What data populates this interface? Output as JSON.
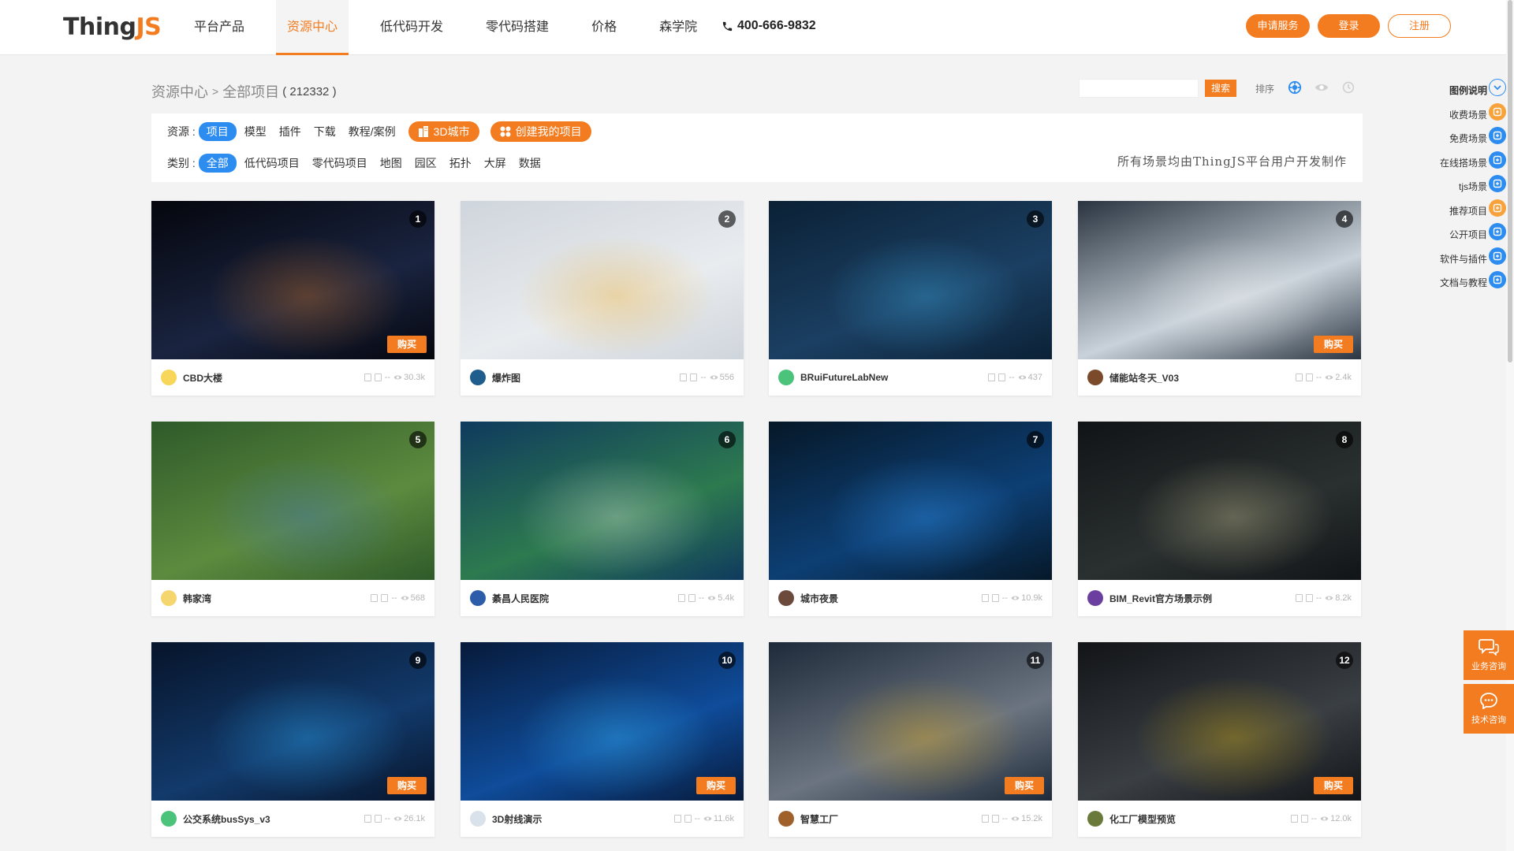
{
  "header": {
    "logo_main": "Thing",
    "logo_accent": "JS",
    "nav": [
      {
        "label": "平台产品"
      },
      {
        "label": "资源中心"
      },
      {
        "label": "低代码开发"
      },
      {
        "label": "零代码搭建"
      },
      {
        "label": "价格"
      },
      {
        "label": "森学院"
      }
    ],
    "active_nav": "资源中心",
    "phone": "400-666-9832",
    "apply_label": "申请服务",
    "login_label": "登录",
    "register_label": "注册"
  },
  "breadcrumb": {
    "root": "资源中心",
    "separator": ">",
    "current": "全部项目",
    "count": "( 212332 )"
  },
  "toolbar": {
    "search_button": "搜索",
    "sort_label": "排序"
  },
  "filters": {
    "resource_label": "资源 :",
    "resource_items": [
      {
        "label": "项目",
        "selected": true
      },
      {
        "label": "模型",
        "selected": false
      },
      {
        "label": "插件",
        "selected": false
      },
      {
        "label": "下载",
        "selected": false
      },
      {
        "label": "教程/案例",
        "selected": false
      }
    ],
    "city_button": "3D城市",
    "create_button": "创建我的项目",
    "category_label": "类别 :",
    "category_items": [
      {
        "label": "全部",
        "selected": true
      },
      {
        "label": "低代码项目",
        "selected": false
      },
      {
        "label": "零代码项目",
        "selected": false
      },
      {
        "label": "地图",
        "selected": false
      },
      {
        "label": "园区",
        "selected": false
      },
      {
        "label": "拓扑",
        "selected": false
      },
      {
        "label": "大屏",
        "selected": false
      },
      {
        "label": "数据",
        "selected": false
      }
    ],
    "disclaimer": "所有场景均由ThingJS平台用户开发制作"
  },
  "legend": {
    "title": "图例说明",
    "items": [
      {
        "label": "收费场景",
        "icon": "paid-scene-icon",
        "color": "#f7a23b"
      },
      {
        "label": "免费场景",
        "icon": "free-scene-icon",
        "color": "#2d8cf0"
      },
      {
        "label": "在线搭场景",
        "icon": "online-build-icon",
        "color": "#2d8cf0"
      },
      {
        "label": "tjs场景",
        "icon": "tjs-scene-icon",
        "color": "#2d8cf0"
      },
      {
        "label": "推荐项目",
        "icon": "recommend-icon",
        "color": "#f7a23b"
      },
      {
        "label": "公开项目",
        "icon": "public-project-icon",
        "color": "#2d8cf0"
      },
      {
        "label": "软件与插件",
        "icon": "software-plugin-icon",
        "color": "#2d8cf0"
      },
      {
        "label": "文档与教程",
        "icon": "docs-tutorial-icon",
        "color": "#2d8cf0"
      }
    ]
  },
  "float_buttons": {
    "business": "业务咨询",
    "tech": "技术咨询"
  },
  "projects": [
    {
      "num": "1",
      "title": "CBD大楼",
      "views": "30.3k",
      "buy": "购买",
      "dash": "--"
    },
    {
      "num": "2",
      "title": "爆炸图",
      "views": "556",
      "buy": "",
      "dash": "--"
    },
    {
      "num": "3",
      "title": "BRuiFutureLabNew",
      "views": "437",
      "buy": "",
      "dash": "--"
    },
    {
      "num": "4",
      "title": "储能站冬天_V03",
      "views": "2.4k",
      "buy": "购买",
      "dash": "--"
    },
    {
      "num": "5",
      "title": "韩家湾",
      "views": "568",
      "buy": "",
      "dash": "--"
    },
    {
      "num": "6",
      "title": "綦昌人民医院",
      "views": "5.4k",
      "buy": "",
      "dash": "--"
    },
    {
      "num": "7",
      "title": "城市夜景",
      "views": "10.9k",
      "buy": "",
      "dash": "--"
    },
    {
      "num": "8",
      "title": "BIM_Revit官方场景示例",
      "views": "8.2k",
      "buy": "",
      "dash": "--"
    },
    {
      "num": "9",
      "title": "公交系统busSys_v3",
      "views": "26.1k",
      "buy": "购买",
      "dash": "--"
    },
    {
      "num": "10",
      "title": "3D射线演示",
      "views": "11.6k",
      "buy": "购买",
      "dash": "--"
    },
    {
      "num": "11",
      "title": "智慧工厂",
      "views": "15.2k",
      "buy": "购买",
      "dash": "--"
    },
    {
      "num": "12",
      "title": "化工厂模型预览",
      "views": "12.0k",
      "buy": "购买",
      "dash": "--"
    }
  ]
}
